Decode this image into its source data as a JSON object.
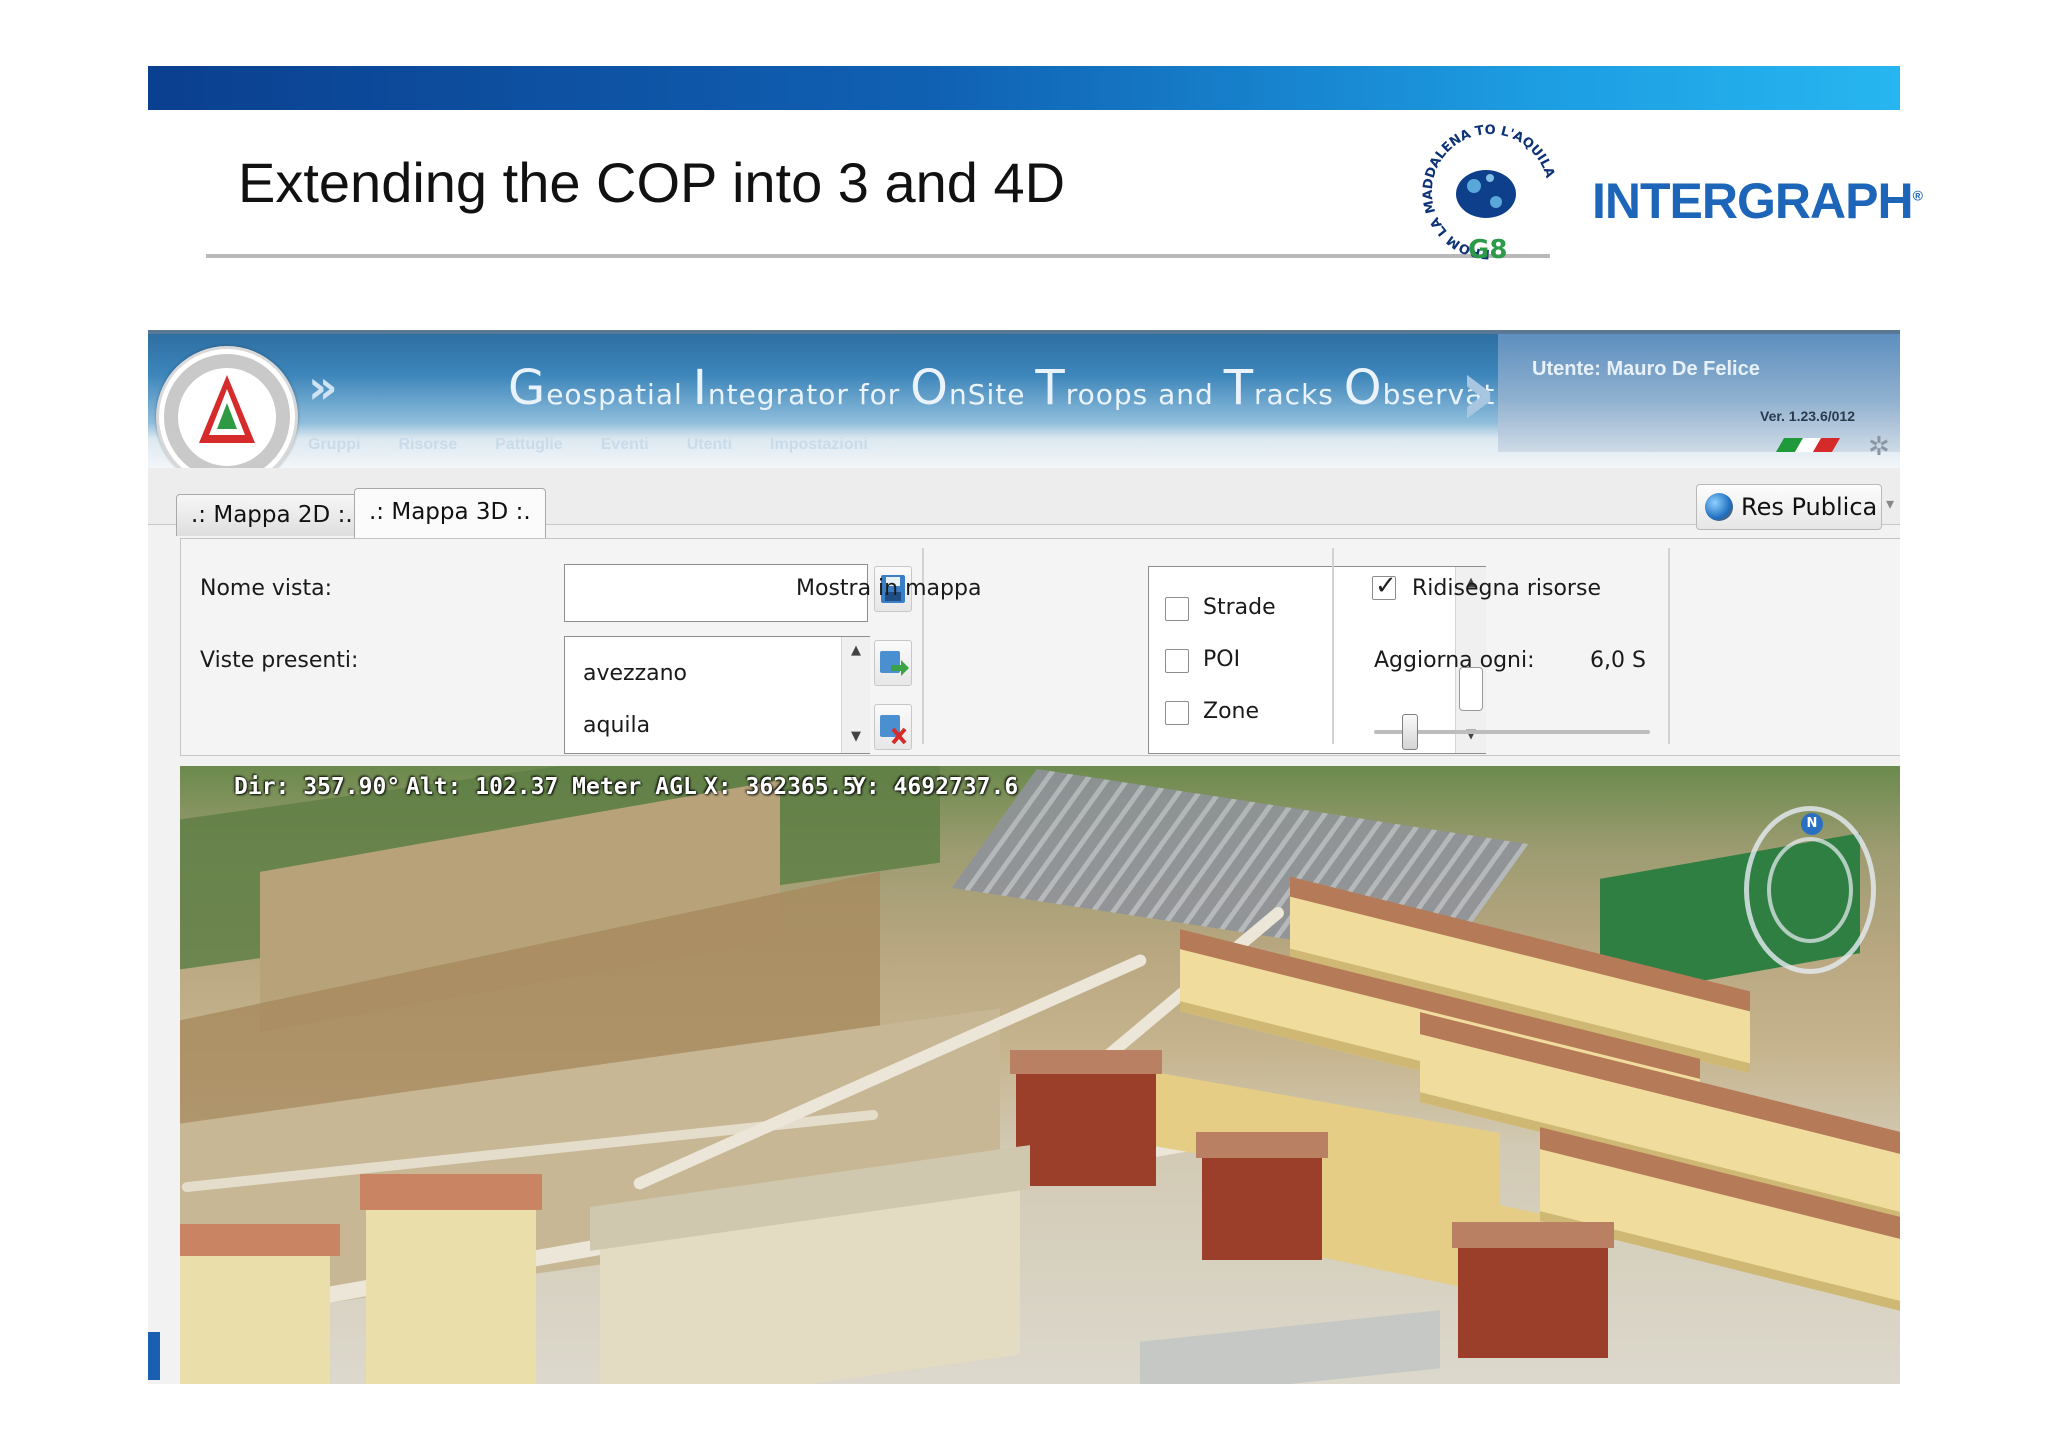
{
  "slide": {
    "title": "Extending the COP into 3 and 4D",
    "logos": {
      "g8_ring_text": "FROM LA MADDALENA TO L'AQUILA",
      "g8_label": "G8",
      "intergraph": "INTERGRAPH",
      "intergraph_mark": "®"
    }
  },
  "app": {
    "title_segments": [
      {
        "cap": "G",
        "rest": "eospatial "
      },
      {
        "cap": "I",
        "rest": "ntegrator for "
      },
      {
        "cap": "O",
        "rest": "nSite "
      },
      {
        "cap": "T",
        "rest": "roops and "
      },
      {
        "cap": "T",
        "rest": "racks "
      },
      {
        "cap": "O",
        "rest": "bservation"
      }
    ],
    "user": "Utente: Mauro De Felice",
    "version": "Ver. 1.23.6/012",
    "menu": [
      "Gruppi",
      "Risorse",
      "Pattuglie",
      "Eventi",
      "Utenti",
      "Impostazioni"
    ],
    "flag_colors": [
      "#1f9a3a",
      "#ffffff",
      "#d42a2a"
    ],
    "tabs": {
      "map2d": ".: Mappa 2D :.",
      "map3d": ".: Mappa 3D :."
    },
    "res_button": "Res Publica",
    "panel": {
      "nome_vista_label": "Nome vista:",
      "nome_vista_value": "",
      "viste_presenti_label": "Viste presenti:",
      "viste": [
        "avezzano",
        "aquila"
      ],
      "mostra_label": "Mostra in mappa",
      "layers": [
        {
          "label": "Strade",
          "checked": false
        },
        {
          "label": "POI",
          "checked": false
        },
        {
          "label": "Zone",
          "checked": false
        }
      ],
      "ridisegna_label": "Ridisegna risorse",
      "ridisegna_checked": true,
      "aggiorna_label": "Aggiorna ogni:",
      "aggiorna_value": "6,0 S",
      "aggiorna_slider_fraction": 0.13
    },
    "map": {
      "dir": "Dir: 357.90°",
      "alt": "Alt: 102.37 Meter AGL",
      "x": "X: 362365.5",
      "y": "Y: 4692737.6",
      "compass_label": "N"
    },
    "colors": {
      "header_blue": "#3c85ba",
      "slide_bar_start": "#0b3f8f",
      "slide_bar_end": "#27b6ef",
      "intergraph_blue": "#1d65b8"
    }
  }
}
